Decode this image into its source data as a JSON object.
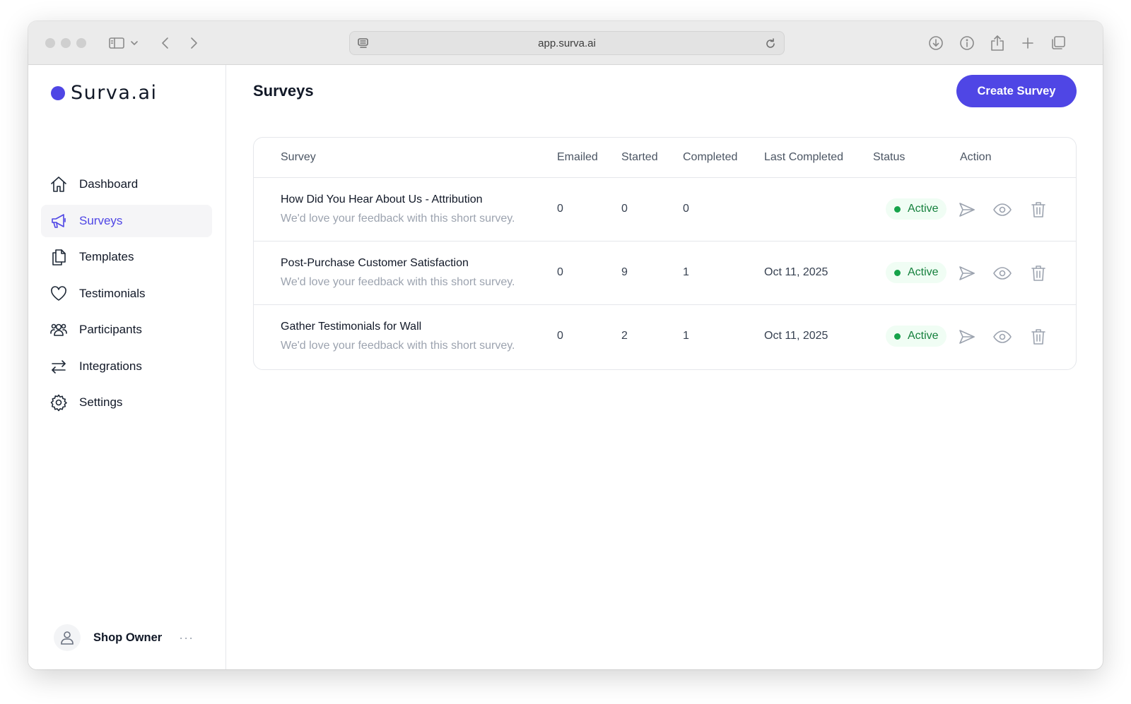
{
  "browser": {
    "url": "app.surva.ai"
  },
  "brand": {
    "name": "Surva.ai",
    "accent_color": "#4f46e5"
  },
  "sidebar": {
    "items": [
      {
        "label": "Dashboard",
        "icon": "home-icon",
        "active": false
      },
      {
        "label": "Surveys",
        "icon": "megaphone-icon",
        "active": true
      },
      {
        "label": "Templates",
        "icon": "documents-icon",
        "active": false
      },
      {
        "label": "Testimonials",
        "icon": "heart-icon",
        "active": false
      },
      {
        "label": "Participants",
        "icon": "users-icon",
        "active": false
      },
      {
        "label": "Integrations",
        "icon": "arrows-exchange-icon",
        "active": false
      },
      {
        "label": "Settings",
        "icon": "gear-icon",
        "active": false
      }
    ],
    "user": {
      "name": "Shop Owner",
      "more_label": "···"
    }
  },
  "main": {
    "title": "Surveys",
    "create_button": "Create Survey",
    "table": {
      "columns": [
        "Survey",
        "Emailed",
        "Started",
        "Completed",
        "Last Completed",
        "Status",
        "Action"
      ],
      "rows": [
        {
          "name": "How Did You Hear About Us - Attribution",
          "description": "We'd love your feedback with this short survey.",
          "emailed": "0",
          "started": "0",
          "completed": "0",
          "last_completed": "",
          "status": "Active"
        },
        {
          "name": "Post-Purchase Customer Satisfaction",
          "description": "We'd love your feedback with this short survey.",
          "emailed": "0",
          "started": "9",
          "completed": "1",
          "last_completed": "Oct 11, 2025",
          "status": "Active"
        },
        {
          "name": "Gather Testimonials for Wall",
          "description": "We'd love your feedback with this short survey.",
          "emailed": "0",
          "started": "2",
          "completed": "1",
          "last_completed": "Oct 11, 2025",
          "status": "Active"
        }
      ]
    }
  }
}
